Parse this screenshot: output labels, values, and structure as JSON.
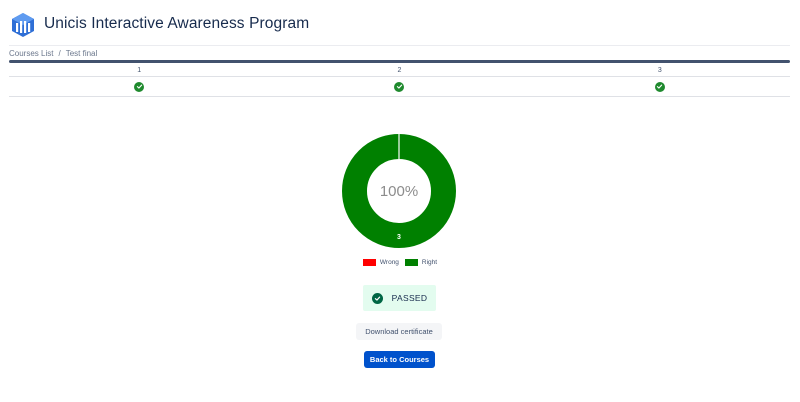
{
  "header": {
    "logo_icon": "unicis-logo-icon",
    "title": "Unicis Interactive Awareness Program"
  },
  "breadcrumb": {
    "items": [
      "Courses List",
      "Test final"
    ],
    "separator": "/"
  },
  "progress": {
    "value": 1.0,
    "color": "#42526e"
  },
  "steps": [
    {
      "number": "1",
      "status": "correct",
      "icon": "check-circle-icon"
    },
    {
      "number": "2",
      "status": "correct",
      "icon": "check-circle-icon"
    },
    {
      "number": "3",
      "status": "correct",
      "icon": "check-circle-icon"
    }
  ],
  "result_chart": {
    "type": "pie",
    "center_label": "100%",
    "segments": [
      {
        "name": "Wrong",
        "value": 0,
        "color": "#ff0000"
      },
      {
        "name": "Right",
        "value": 3,
        "color": "#008000"
      }
    ],
    "segment_label": "3"
  },
  "legend": {
    "items": [
      {
        "label": "Wrong",
        "color": "#ff0000"
      },
      {
        "label": "Right",
        "color": "#008000"
      }
    ]
  },
  "result": {
    "status_text": "PASSED",
    "icon": "check-circle-icon",
    "color": "#006644",
    "background": "#e3fcef"
  },
  "actions": {
    "download_label": "Download certificate",
    "back_label": "Back to Courses",
    "back_color": "#0052cc"
  }
}
